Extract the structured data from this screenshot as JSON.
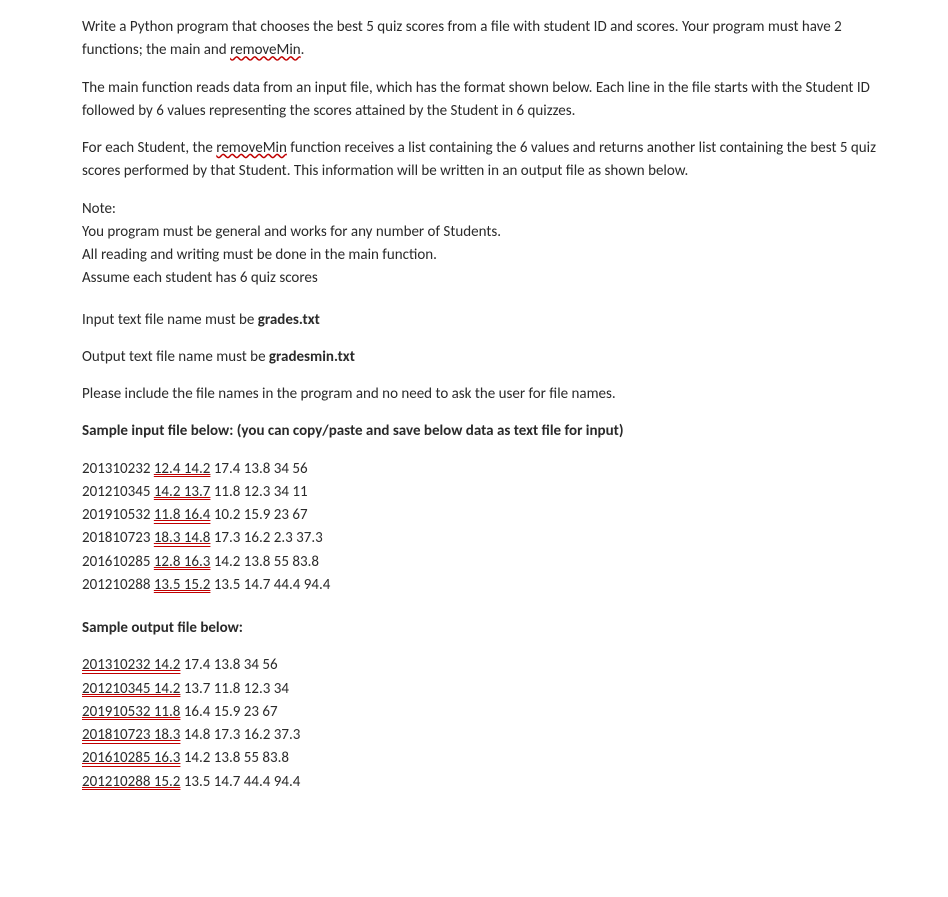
{
  "p1_a": "Write a Python program that chooses the best 5 quiz scores from a file with student ID and scores. Your program must have 2 functions; the main and ",
  "p1_b": "removeMin",
  "p1_c": ".",
  "p2": "The main function reads data from an input file, which has the format shown below.  Each line in the file starts with the Student ID followed by 6 values representing the scores attained by the Student in 6 quizzes.",
  "p3_a": "For each Student, the ",
  "p3_b": "removeMin",
  "p3_c": " function receives a list containing the 6 values and returns another list containing the best 5 quiz scores performed by that Student. This information will be written in an output file as shown below.",
  "note_head": "Note:",
  "note_1": "You program must be general and works for any number of Students.",
  "note_2": "All reading and writing must be done in the main function.",
  "note_3": "Assume each student has 6 quiz scores",
  "in_a": "Input text file name must be ",
  "in_b": "grades.txt",
  "out_a": "Output text file name must be ",
  "out_b": "gradesmin.txt",
  "include": "Please include the file names in the program and no need to ask the user for file names.",
  "sample_in_head": "Sample input file below: (you can copy/paste and save below data as text file for input)",
  "in1_a": "201310232   ",
  "in1_b": "12.4  14.2",
  "in1_c": "  17.4   13.8   34  56",
  "in2_a": "201210345   ",
  "in2_b": "14.2  13.7",
  "in2_c": "  11.8   12.3  34  11",
  "in3_a": "201910532   ",
  "in3_b": "11.8  16.4",
  "in3_c": "  10.2   15.9  23  67",
  "in4_a": "201810723   ",
  "in4_b": "18.3  14.8",
  "in4_c": "  17.3   16.2  2.3  37.3",
  "in5_a": "201610285   ",
  "in5_b": "12.8  16.3",
  "in5_c": "  14.2   13.8  55  83.8",
  "in6_a": "201210288   ",
  "in6_b": "13.5  15.2",
  "in6_c": "  13.5   14.7  44.4  94.4",
  "sample_out_head": "Sample output file below:",
  "o1_a": "201310232  14.2",
  "o1_b": "  17.4  13.8  34  56",
  "o2_a": "201210345  14.2",
  "o2_b": "  13.7  11.8  12.3  34",
  "o3_a": "201910532  11.8",
  "o3_b": "  16.4  15.9  23  67",
  "o4_a": "201810723  18.3",
  "o4_b": "  14.8  17.3  16.2  37.3",
  "o5_a": "201610285  16.3",
  "o5_b": "  14.2  13.8  55  83.8",
  "o6_a": "201210288  15.2",
  "o6_b": "  13.5  14.7  44.4  94.4"
}
